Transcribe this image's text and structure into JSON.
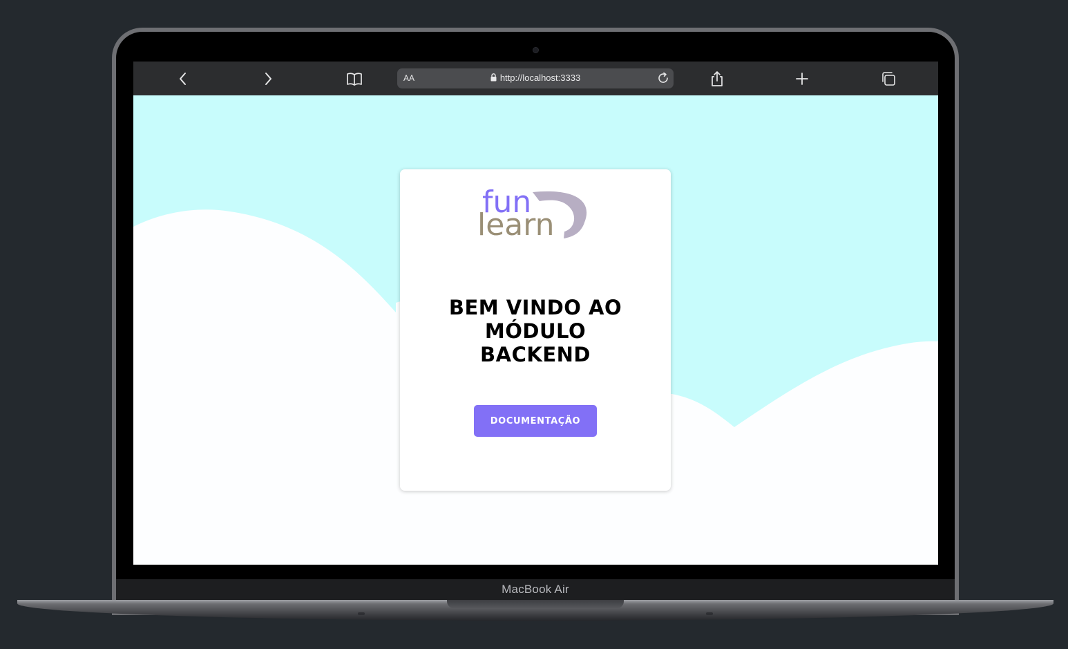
{
  "device": {
    "label": "MacBook Air"
  },
  "browser": {
    "text_size_label": "AA",
    "url": "http://localhost:3333",
    "icons": [
      "back-icon",
      "forward-icon",
      "bookmarks-icon",
      "lock-icon",
      "reload-icon",
      "share-icon",
      "new-tab-icon",
      "tabs-icon"
    ]
  },
  "logo": {
    "line1": "fun",
    "line2": "learn"
  },
  "hero": {
    "title_line1": "BEM VINDO AO MÓDULO",
    "title_line2": "BACKEND",
    "button_label": "DOCUMENTAÇÃO"
  },
  "colors": {
    "page_sky": "#c8fcfc",
    "accent": "#8270f6",
    "logo_fun": "#8270f6",
    "logo_learn": "#9a8f76",
    "logo_arc": "#b7aec3"
  }
}
